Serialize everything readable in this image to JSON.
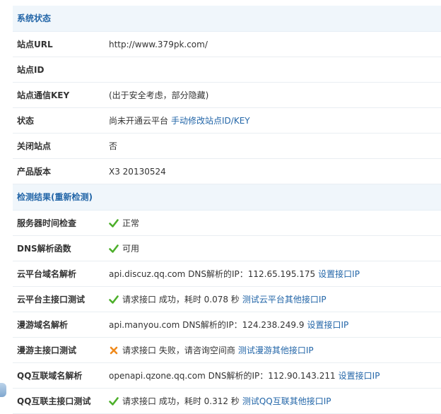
{
  "system_status": {
    "title": "系统状态",
    "site_url_label": "站点URL",
    "site_url_value": "http://www.379pk.com/",
    "site_id_label": "站点ID",
    "site_id_value": "",
    "site_key_label": "站点通信KEY",
    "site_key_value": "(出于安全考虑，部分隐藏)",
    "status_label": "状态",
    "status_value": "尚未开通云平台",
    "status_link": "手动修改站点ID/KEY",
    "close_site_label": "关闭站点",
    "close_site_value": "否",
    "version_label": "产品版本",
    "version_value": "X3 20130524"
  },
  "check_results": {
    "title_prefix": "检测结果(",
    "recheck_link": "重新检测",
    "title_suffix": ")",
    "rows": [
      {
        "label": "服务器时间检查",
        "status": "ok",
        "text": "正常"
      },
      {
        "label": "DNS解析函数",
        "status": "ok",
        "text": "可用"
      },
      {
        "label": "云平台域名解析",
        "text": "api.discuz.qq.com DNS解析的IP：112.65.195.175",
        "link": "设置接口IP"
      },
      {
        "label": "云平台主接口测试",
        "status": "ok",
        "text": "请求接口 成功，耗时 0.078 秒",
        "link": "测试云平台其他接口IP"
      },
      {
        "label": "漫游域名解析",
        "text": "api.manyou.com DNS解析的IP：124.238.249.9",
        "link": "设置接口IP"
      },
      {
        "label": "漫游主接口测试",
        "status": "fail",
        "text": "请求接口 失败，请咨询空间商",
        "link": "测试漫游其他接口IP"
      },
      {
        "label": "QQ互联域名解析",
        "text": "openapi.qzone.qq.com DNS解析的IP：112.90.143.211",
        "link": "设置接口IP"
      },
      {
        "label": "QQ互联主接口测试",
        "status": "ok",
        "text": "请求接口 成功，耗时 0.312 秒",
        "link": "测试QQ互联其他接口IP"
      }
    ]
  },
  "icons": {
    "ok": "check-icon",
    "fail": "cross-icon"
  },
  "colors": {
    "link": "#2366a8",
    "header_bg": "#f0f6fb",
    "ok": "#4caf2a",
    "fail": "#f08a1c"
  }
}
